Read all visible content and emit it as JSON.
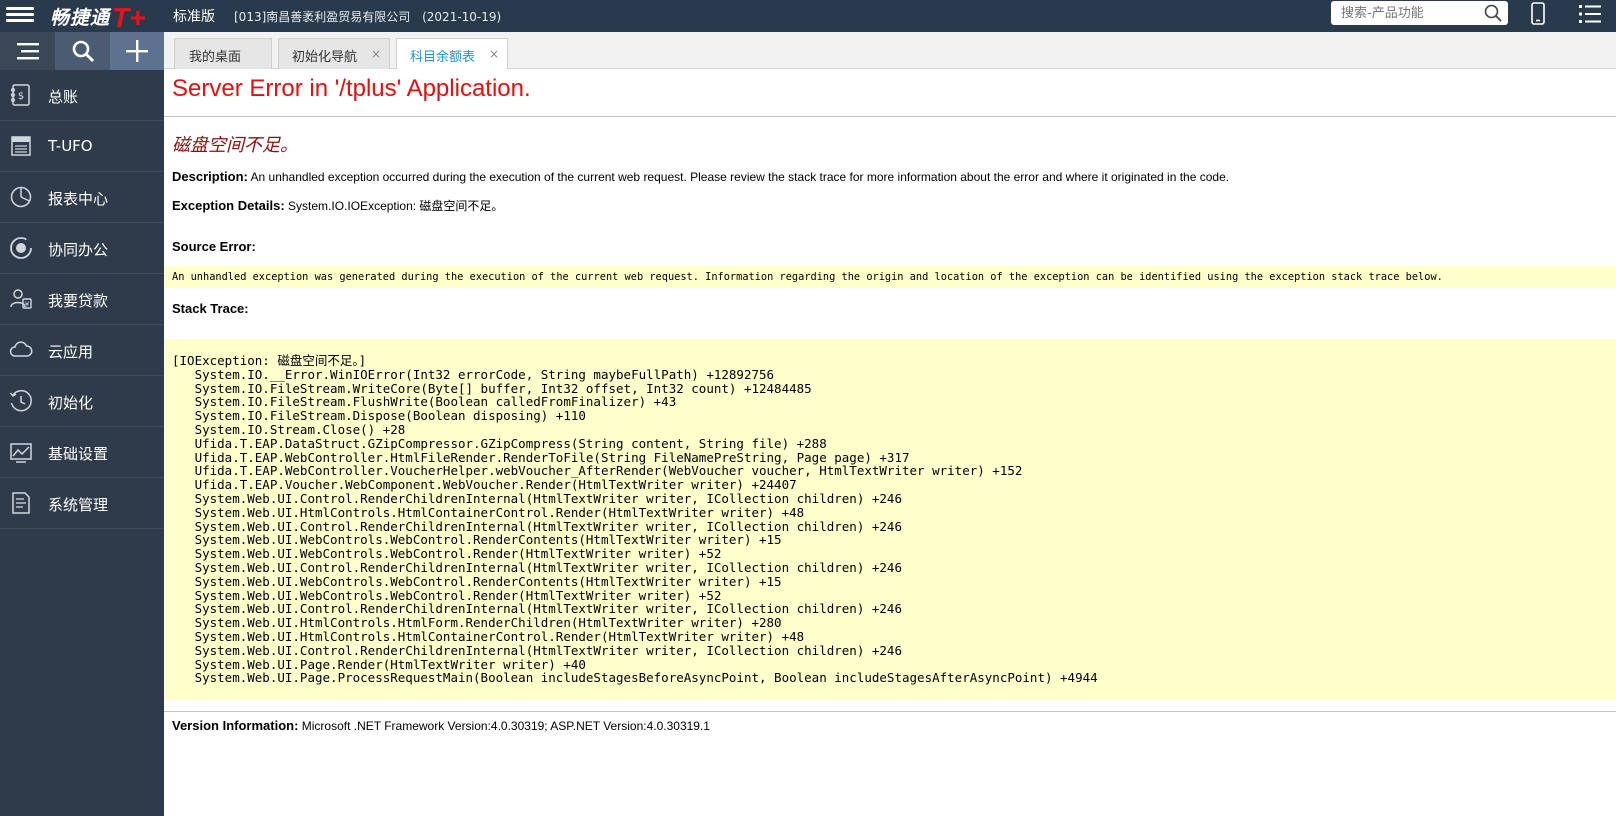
{
  "topbar": {
    "brand_name": "畅捷通",
    "brand_mark": "T+",
    "edition": "标准版",
    "company": "[013]南昌善袤利盈贸易有限公司",
    "date": "(2021-10-19)",
    "search_placeholder": "搜索-产品功能"
  },
  "sidebar": {
    "items": [
      {
        "label": "总账",
        "icon": "ledger-icon"
      },
      {
        "label": "T-UFO",
        "icon": "tufo-icon"
      },
      {
        "label": "报表中心",
        "icon": "pie-chart-icon"
      },
      {
        "label": "协同办公",
        "icon": "collaboration-icon"
      },
      {
        "label": "我要贷款",
        "icon": "loan-icon"
      },
      {
        "label": "云应用",
        "icon": "cloud-icon"
      },
      {
        "label": "初始化",
        "icon": "init-clock-icon"
      },
      {
        "label": "基础设置",
        "icon": "settings-chart-icon"
      },
      {
        "label": "系统管理",
        "icon": "system-doc-icon"
      }
    ]
  },
  "tabs": [
    {
      "label": "我的桌面",
      "closable": false,
      "active": false
    },
    {
      "label": "初始化导航",
      "closable": true,
      "active": false
    },
    {
      "label": "科目余额表",
      "closable": true,
      "active": true
    }
  ],
  "close_glyph": "×",
  "error": {
    "title": "Server Error in '/tplus' Application.",
    "message": "磁盘空间不足。",
    "description_label": "Description:",
    "description": "An unhandled exception occurred during the execution of the current web request. Please review the stack trace for more information about the error and where it originated in the code.",
    "exception_label": "Exception Details:",
    "exception": "System.IO.IOException: 磁盘空间不足。",
    "source_label": "Source Error:",
    "source_text": "An unhandled exception was generated during the execution of the current web request. Information regarding the origin and location of the exception can be identified using the exception stack trace below.",
    "stack_label": "Stack Trace:",
    "stack_trace": "[IOException: 磁盘空间不足。]\n   System.IO.__Error.WinIOError(Int32 errorCode, String maybeFullPath) +12892756\n   System.IO.FileStream.WriteCore(Byte[] buffer, Int32 offset, Int32 count) +12484485\n   System.IO.FileStream.FlushWrite(Boolean calledFromFinalizer) +43\n   System.IO.FileStream.Dispose(Boolean disposing) +110\n   System.IO.Stream.Close() +28\n   Ufida.T.EAP.DataStruct.GZipCompressor.GZipCompress(String content, String file) +288\n   Ufida.T.EAP.WebController.HtmlFileRender.RenderToFile(String FileNamePreString, Page page) +317\n   Ufida.T.EAP.WebController.VoucherHelper.webVoucher_AfterRender(WebVoucher voucher, HtmlTextWriter writer) +152\n   Ufida.T.EAP.Voucher.WebComponent.WebVoucher.Render(HtmlTextWriter writer) +24407\n   System.Web.UI.Control.RenderChildrenInternal(HtmlTextWriter writer, ICollection children) +246\n   System.Web.UI.HtmlControls.HtmlContainerControl.Render(HtmlTextWriter writer) +48\n   System.Web.UI.Control.RenderChildrenInternal(HtmlTextWriter writer, ICollection children) +246\n   System.Web.UI.WebControls.WebControl.RenderContents(HtmlTextWriter writer) +15\n   System.Web.UI.WebControls.WebControl.Render(HtmlTextWriter writer) +52\n   System.Web.UI.Control.RenderChildrenInternal(HtmlTextWriter writer, ICollection children) +246\n   System.Web.UI.WebControls.WebControl.RenderContents(HtmlTextWriter writer) +15\n   System.Web.UI.WebControls.WebControl.Render(HtmlTextWriter writer) +52\n   System.Web.UI.Control.RenderChildrenInternal(HtmlTextWriter writer, ICollection children) +246\n   System.Web.UI.HtmlControls.HtmlForm.RenderChildren(HtmlTextWriter writer) +280\n   System.Web.UI.HtmlControls.HtmlContainerControl.Render(HtmlTextWriter writer) +48\n   System.Web.UI.Control.RenderChildrenInternal(HtmlTextWriter writer, ICollection children) +246\n   System.Web.UI.Page.Render(HtmlTextWriter writer) +40\n   System.Web.UI.Page.ProcessRequestMain(Boolean includeStagesBeforeAsyncPoint, Boolean includeStagesAfterAsyncPoint) +4944",
    "version_label": "Version Information:",
    "version": "Microsoft .NET Framework Version:4.0.30319; ASP.NET Version:4.0.30319.1"
  },
  "colors": {
    "topbar_bg": "#2a3a4d",
    "sidebar_bg": "#2f3b4a",
    "title_red": "#e01010",
    "message_red": "#8b0f0f",
    "code_bg": "#ffffcc",
    "tab_active": "#2a8fd3",
    "brand_mark": "#e4141b"
  }
}
